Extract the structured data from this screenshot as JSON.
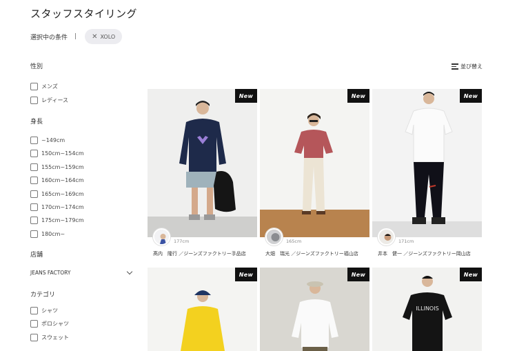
{
  "page": {
    "title": "スタッフスタイリング"
  },
  "conditions": {
    "label": "選択中の条件",
    "separator": "|",
    "chip": "XOLO",
    "chip_close": "✕"
  },
  "sort": {
    "label": "並び替え"
  },
  "filters": {
    "gender": {
      "title": "性別",
      "options": [
        "メンズ",
        "レディース"
      ]
    },
    "height": {
      "title": "身長",
      "options": [
        "~149cm",
        "150cm~154cm",
        "155cm~159cm",
        "160cm~164cm",
        "165cm~169cm",
        "170cm~174cm",
        "175cm~179cm",
        "180cm~"
      ]
    },
    "store": {
      "title": "店舗",
      "selected": "JEANS FACTORY"
    },
    "category": {
      "title": "カテゴリ",
      "options": [
        "シャツ",
        "ポロシャツ",
        "スウェット"
      ]
    }
  },
  "colors": {
    "badge_bg": "#111111",
    "chip_bg": "#ececf0"
  },
  "cards": [
    {
      "badge": "New",
      "height": "177cm",
      "name": "髙内　隆行 ／ジーンズファクトリー手品店"
    },
    {
      "badge": "New",
      "height": "165cm",
      "name": "大畑　瑞光 ／ジーンズファクトリー福山店"
    },
    {
      "badge": "New",
      "height": "171cm",
      "name": "井本　健一 ／ジーンズファクトリー岡山店"
    },
    {
      "badge": "New"
    },
    {
      "badge": "New"
    },
    {
      "badge": "New"
    }
  ]
}
